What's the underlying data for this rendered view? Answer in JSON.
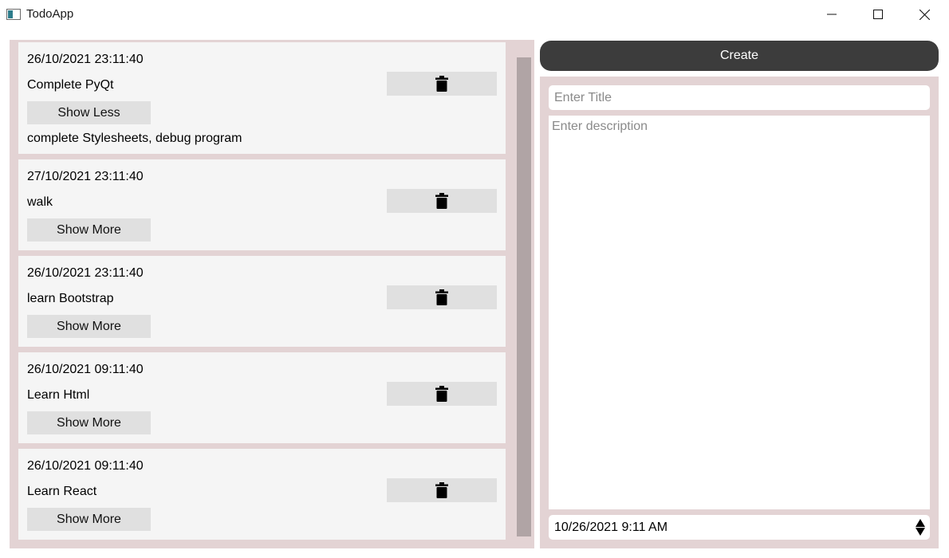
{
  "window": {
    "title": "TodoApp",
    "icons": {
      "app": "app-window-icon",
      "minimize": "minimize-icon",
      "maximize": "maximize-icon",
      "close": "close-icon"
    }
  },
  "todos": [
    {
      "date": "26/10/2021 23:11:40",
      "title": "Complete PyQt",
      "toggle_label": "Show Less",
      "description": "complete Stylesheets, debug program",
      "expanded": true
    },
    {
      "date": "27/10/2021 23:11:40",
      "title": "walk",
      "toggle_label": "Show More",
      "expanded": false
    },
    {
      "date": "26/10/2021 23:11:40",
      "title": "learn Bootstrap",
      "toggle_label": "Show More",
      "expanded": false
    },
    {
      "date": "26/10/2021 09:11:40",
      "title": "Learn Html",
      "toggle_label": "Show More",
      "expanded": false
    },
    {
      "date": "26/10/2021 09:11:40",
      "title": "Learn React",
      "toggle_label": "Show More",
      "expanded": false
    }
  ],
  "delete_icon": "trash-icon",
  "form": {
    "create_label": "Create",
    "title_placeholder": "Enter Title",
    "description_placeholder": "Enter description",
    "datetime_value": "10/26/2021 9:11 AM"
  },
  "colors": {
    "panel_bg": "#e3d3d4",
    "card_bg": "#f5f5f5",
    "button_bg": "#e0e0e0",
    "create_bg": "#3c3c3c",
    "scrollbar": "#b0a4a5"
  }
}
